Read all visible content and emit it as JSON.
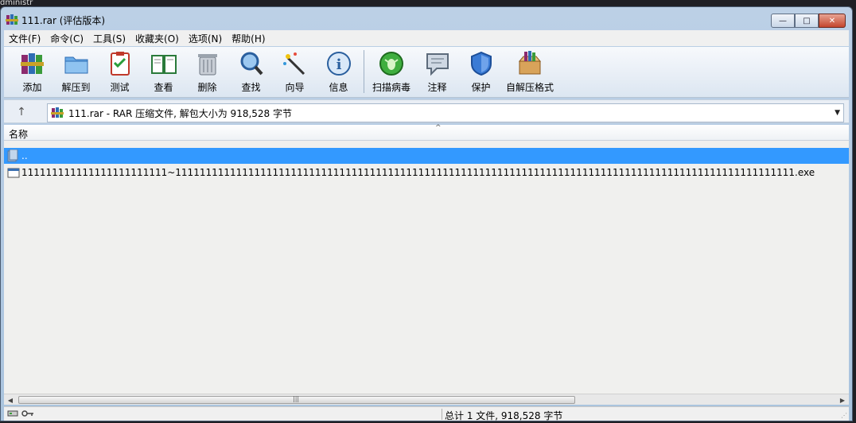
{
  "desktop_text": "dministr",
  "window": {
    "title": "111.rar (评估版本)",
    "caption": {
      "minimize": "—",
      "maximize": "□",
      "close": "✕"
    }
  },
  "menu": [
    "文件(F)",
    "命令(C)",
    "工具(S)",
    "收藏夹(O)",
    "选项(N)",
    "帮助(H)"
  ],
  "toolbar": [
    {
      "label": "添加",
      "icon": "add-books-icon"
    },
    {
      "label": "解压到",
      "icon": "extract-folder-icon"
    },
    {
      "label": "测试",
      "icon": "test-clipboard-icon"
    },
    {
      "label": "查看",
      "icon": "view-book-icon"
    },
    {
      "label": "删除",
      "icon": "trash-icon"
    },
    {
      "label": "查找",
      "icon": "magnifier-icon"
    },
    {
      "label": "向导",
      "icon": "wizard-wand-icon"
    },
    {
      "label": "信息",
      "icon": "info-icon"
    },
    {
      "label": "扫描病毒",
      "icon": "virus-scan-icon"
    },
    {
      "label": "注释",
      "icon": "comment-icon"
    },
    {
      "label": "保护",
      "icon": "shield-icon"
    },
    {
      "label": "自解压格式",
      "icon": "sfx-box-icon"
    }
  ],
  "address": {
    "text": "111.rar - RAR 压缩文件, 解包大小为 918,528 字节"
  },
  "list": {
    "column_name": "名称",
    "rows": [
      {
        "name": "..",
        "icon": "parent-folder-icon",
        "selected": true
      },
      {
        "name": "111111111111111111111111~111111111111111111111111111111111111111111111111111111111111111111111111111111111111111111111111111111.exe",
        "icon": "exe-file-icon",
        "selected": false
      }
    ]
  },
  "status": {
    "text": "总计 1 文件, 918,528 字节"
  },
  "colors": {
    "selection": "#3399ff",
    "window_frame": "#a9c3dd",
    "list_bg": "#f0f0ee"
  }
}
